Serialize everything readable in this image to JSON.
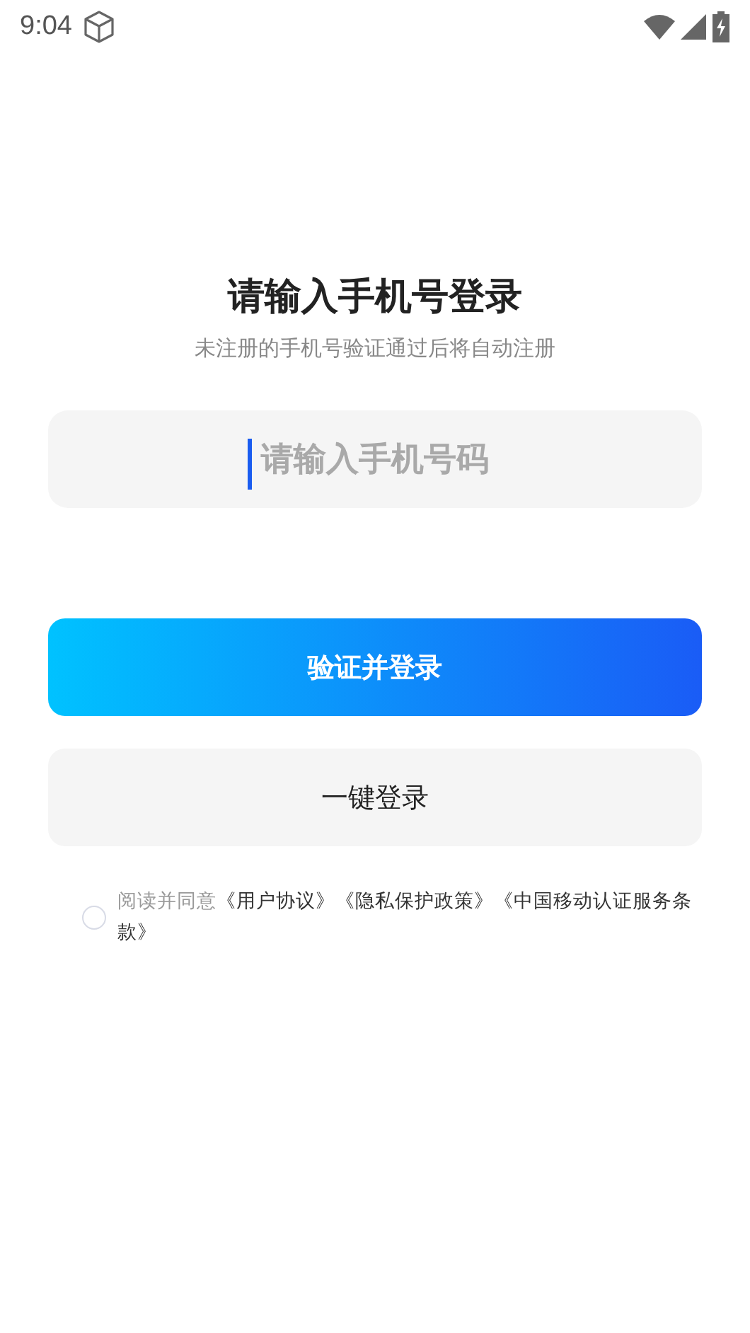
{
  "status_bar": {
    "time": "9:04"
  },
  "heading": {
    "title": "请输入手机号登录",
    "subtitle": "未注册的手机号验证通过后将自动注册"
  },
  "phone_field": {
    "placeholder": "请输入手机号码",
    "focused": true
  },
  "buttons": [
    {
      "kind": "primary",
      "label": "验证并登录"
    },
    {
      "kind": "secondary",
      "label": "一键登录"
    }
  ],
  "agreement": {
    "checked": false,
    "parts": [
      {
        "kind": "plain",
        "text": "阅读并同意"
      },
      {
        "kind": "link",
        "text": "《用户协议》"
      },
      {
        "kind": "link",
        "text": "《隐私保护政策》"
      },
      {
        "kind": "link",
        "text": "《中国移动认证服务条款》"
      }
    ]
  }
}
